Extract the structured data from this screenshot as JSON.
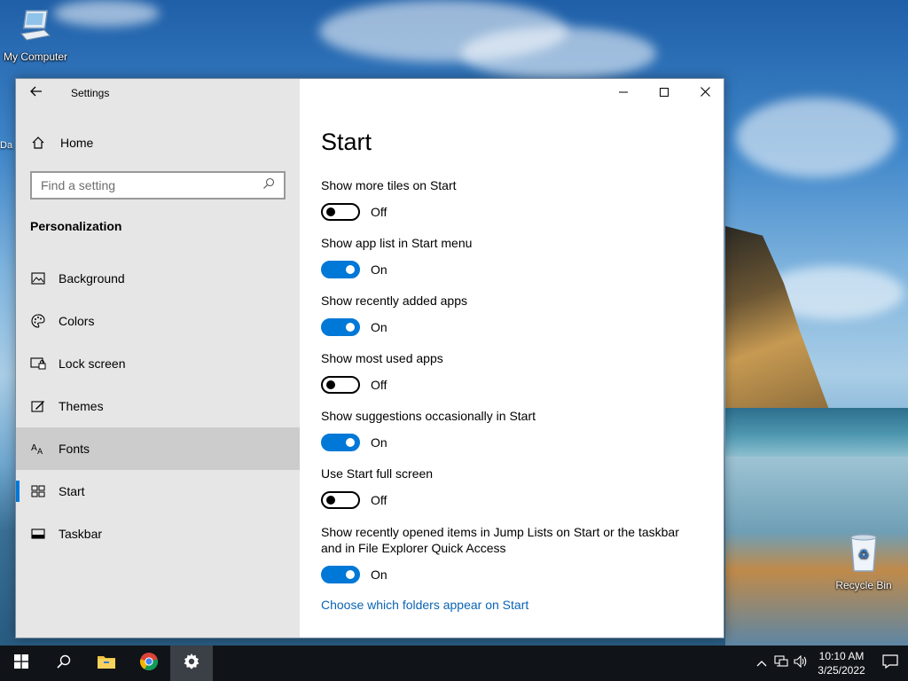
{
  "desktop": {
    "icons": [
      {
        "label": "My Computer",
        "icon": "computer-icon"
      },
      {
        "label": "Recycle Bin",
        "icon": "recycle-bin-icon"
      }
    ],
    "cut_label": "Da"
  },
  "settings_window": {
    "title": "Settings",
    "home_label": "Home",
    "search_placeholder": "Find a setting",
    "section_title": "Personalization",
    "nav_items": [
      {
        "label": "Background",
        "icon": "picture-icon"
      },
      {
        "label": "Colors",
        "icon": "palette-icon"
      },
      {
        "label": "Lock screen",
        "icon": "lock-screen-icon"
      },
      {
        "label": "Themes",
        "icon": "themes-icon"
      },
      {
        "label": "Fonts",
        "icon": "fonts-icon"
      },
      {
        "label": "Start",
        "icon": "start-layout-icon"
      },
      {
        "label": "Taskbar",
        "icon": "taskbar-icon"
      }
    ],
    "page_title": "Start",
    "settings": [
      {
        "label": "Show more tiles on Start",
        "state": "Off"
      },
      {
        "label": "Show app list in Start menu",
        "state": "On"
      },
      {
        "label": "Show recently added apps",
        "state": "On"
      },
      {
        "label": "Show most used apps",
        "state": "Off"
      },
      {
        "label": "Show suggestions occasionally in Start",
        "state": "On"
      },
      {
        "label": "Use Start full screen",
        "state": "Off"
      },
      {
        "label": "Show recently opened items in Jump Lists on Start or the taskbar and in File Explorer Quick Access",
        "state": "On"
      }
    ],
    "link_text": "Choose which folders appear on Start"
  },
  "taskbar": {
    "clock_time": "10:10 AM",
    "clock_date": "3/25/2022"
  },
  "colors": {
    "accent": "#0078d7",
    "sidebar_bg": "#e6e6e6",
    "hover_bg": "#cccccc",
    "link": "#0a64b4",
    "taskbar_bg": "#101318"
  }
}
